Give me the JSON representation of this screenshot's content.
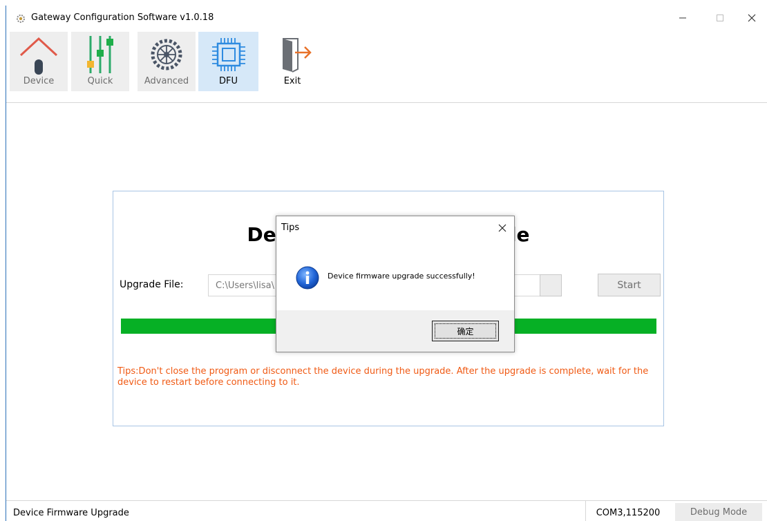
{
  "window": {
    "title": "Gateway Configuration Software v1.0.18"
  },
  "toolbar": {
    "items": [
      {
        "label": "Device",
        "icon": "house-icon",
        "state": "disabled"
      },
      {
        "label": "Quick",
        "icon": "sliders-icon",
        "state": "disabled"
      },
      {
        "label": "Advanced",
        "icon": "gear-icon",
        "state": "disabled"
      },
      {
        "label": "DFU",
        "icon": "chip-icon",
        "state": "active"
      },
      {
        "label": "Exit",
        "icon": "exit-door-icon",
        "state": "normal"
      }
    ]
  },
  "panel": {
    "heading": "Device Firmware Upgrade",
    "upgrade_label": "Upgrade File:",
    "file_path": "C:\\Users\\lisa\\",
    "start_label": "Start",
    "progress_fraction": 1.0,
    "tips": "Tips:Don't close the program or disconnect the device during the upgrade. After the upgrade is complete, wait for the device to restart before connecting to it."
  },
  "dialog": {
    "title": "Tips",
    "message": "Device firmware upgrade successfully!",
    "ok_label": "确定",
    "icon": "info-icon"
  },
  "statusbar": {
    "left_text": "Device Firmware Upgrade",
    "com": "COM3,115200",
    "debug_label": "Debug Mode"
  },
  "colors": {
    "progress": "#06b025",
    "tips": "#f05a14",
    "active_tab": "#d6e8f8",
    "accent_border": "#a7c4e4"
  }
}
